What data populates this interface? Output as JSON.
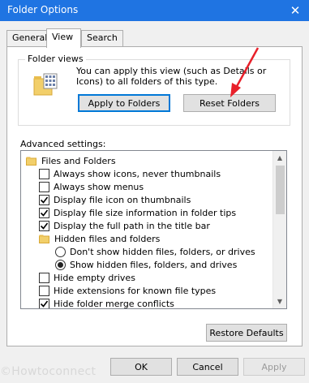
{
  "window": {
    "title": "Folder Options",
    "close_glyph": "✕"
  },
  "tabs": [
    {
      "label": "General",
      "active": false
    },
    {
      "label": "View",
      "active": true
    },
    {
      "label": "Search",
      "active": false
    }
  ],
  "folder_views": {
    "group_label": "Folder views",
    "description": "You can apply this view (such as Details or Icons) to all folders of this type.",
    "icon": "folder-views-icon",
    "apply_button": "Apply to Folders",
    "reset_button": "Reset Folders"
  },
  "advanced": {
    "label": "Advanced settings:",
    "items": [
      {
        "type": "folder",
        "label": "Files and Folders",
        "checked": false
      },
      {
        "type": "checkbox",
        "label": "Always show icons, never thumbnails",
        "checked": false
      },
      {
        "type": "checkbox",
        "label": "Always show menus",
        "checked": false
      },
      {
        "type": "checkbox",
        "label": "Display file icon on thumbnails",
        "checked": true
      },
      {
        "type": "checkbox",
        "label": "Display file size information in folder tips",
        "checked": true
      },
      {
        "type": "checkbox",
        "label": "Display the full path in the title bar",
        "checked": true
      },
      {
        "type": "folder",
        "label": "Hidden files and folders",
        "checked": false
      },
      {
        "type": "radio",
        "label": "Don't show hidden files, folders, or drives",
        "checked": false
      },
      {
        "type": "radio",
        "label": "Show hidden files, folders, and drives",
        "checked": true
      },
      {
        "type": "checkbox",
        "label": "Hide empty drives",
        "checked": false
      },
      {
        "type": "checkbox",
        "label": "Hide extensions for known file types",
        "checked": false
      },
      {
        "type": "checkbox",
        "label": "Hide folder merge conflicts",
        "checked": true
      }
    ],
    "restore_button": "Restore Defaults"
  },
  "footer": {
    "ok": "OK",
    "cancel": "Cancel",
    "apply": "Apply"
  },
  "watermark": "©Howtoconnect",
  "colors": {
    "titlebar": "#1f74e2",
    "annotation_arrow": "#e8202a",
    "default_button_border": "#0078d7"
  }
}
